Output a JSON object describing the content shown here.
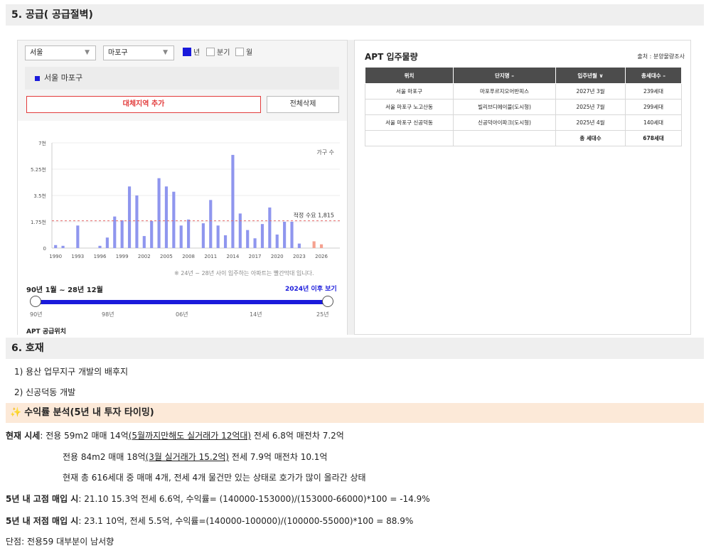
{
  "section5": {
    "title": "5. 공급( 공급절벽)"
  },
  "supply_panel": {
    "city": "서울",
    "district": "마포구",
    "period_options": [
      "년",
      "분기",
      "월"
    ],
    "period_selected": "년",
    "region_tag": "서울 마포구",
    "compare_button": "대체지역 추가",
    "delete_all_button": "전체삭제",
    "chart_note": "※ 24년 ~ 28년 사이 입주하는 아파트는 빨간막대 입니다.",
    "range_label": "90년 1월 ~ 28년 12월",
    "after_link": "2024년 이후 보기",
    "slider_ticks": [
      "90년",
      "98년",
      "06년",
      "14년",
      "25년"
    ],
    "location_label": "APT 공급위치"
  },
  "chart_data": {
    "type": "bar",
    "title": "",
    "legend": "가구 수",
    "xlabel": "",
    "ylabel": "",
    "ylim": [
      0,
      7000
    ],
    "ytick_labels": [
      "0",
      "1.75천",
      "3.5천",
      "5.25천",
      "7천"
    ],
    "xtick_labels": [
      "1990",
      "1993",
      "1996",
      "1999",
      "2002",
      "2005",
      "2008",
      "2011",
      "2014",
      "2017",
      "2020",
      "2023",
      "2026"
    ],
    "categories": [
      "1990",
      "1991",
      "1992",
      "1993",
      "1994",
      "1995",
      "1996",
      "1997",
      "1998",
      "1999",
      "2000",
      "2001",
      "2002",
      "2003",
      "2004",
      "2005",
      "2006",
      "2007",
      "2008",
      "2009",
      "2010",
      "2011",
      "2012",
      "2013",
      "2014",
      "2015",
      "2016",
      "2017",
      "2018",
      "2019",
      "2020",
      "2021",
      "2022",
      "2023",
      "2024",
      "2025",
      "2026",
      "2027",
      "2028"
    ],
    "values": [
      200,
      150,
      0,
      1500,
      0,
      0,
      150,
      700,
      2100,
      1850,
      4100,
      3500,
      800,
      1800,
      4650,
      4100,
      3750,
      1500,
      1900,
      0,
      1650,
      3200,
      1500,
      850,
      6200,
      2300,
      1200,
      650,
      1600,
      2700,
      900,
      1750,
      1750,
      300,
      0,
      450,
      250,
      0,
      0
    ],
    "red_from_year": 2024,
    "reference_line": {
      "label": "적정 수요 1,815",
      "value": 1815
    },
    "colors": {
      "bar": "#8f96ee",
      "future_bar": "#f5a190",
      "reference": "#e36a6a"
    }
  },
  "apt_table": {
    "title": "APT 입주물량",
    "source": "출처 : 분양물량조사",
    "headers": [
      "위치",
      "단지명 –",
      "입주년월 ∨",
      "총세대수 –"
    ],
    "rows": [
      [
        "서울 마포구",
        "마포푸르지오어반피스",
        "2027년 3월",
        "239세대"
      ],
      [
        "서울 마포구 노고산동",
        "빌리브디에이블(도시형)",
        "2025년 7월",
        "299세대"
      ],
      [
        "서울 마포구 신공덕동",
        "신공덕아이파크(도시형)",
        "2025년 4월",
        "140세대"
      ]
    ],
    "total_label": "총 세대수",
    "total_value": "678세대"
  },
  "section6": {
    "title": "6. 호재"
  },
  "hojae_items": [
    "1) 용산 업무지구 개발의 배후지",
    "2) 신공덕동 개발"
  ],
  "roi": {
    "icon": "✨",
    "title": "수익률 분석(5년 내 투자 타이밍)"
  },
  "price": {
    "label": "현재 시세",
    "line1_pre": ": 전용 59m2 매매 14억",
    "line1_u": "(5월까지만해도 실거래가 12억대)",
    "line1_post": " 전세 6.8억 매전차 7.2억",
    "line2_pre": "전용 84m2 매매 18억",
    "line2_u": "(3월 실거래가 15.2억)",
    "line2_post": " 전세 7.9억 매전차 10.1억",
    "line3": "현재 총 616세대 중 매매 4개, 전세 4개 물건만 있는 상태로 호가가 많이 올라간 상태"
  },
  "analysis": {
    "high_label": "5년 내 고점 매입 시",
    "high_text": ": 21.10 15.3억 전세 6.6억, 수익률= (140000-153000)/(153000-66000)*100 = -14.9%",
    "low_label": "5년 내 저점 매입 시",
    "low_text": ": 23.1 10억, 전세 5.5억, 수익률=(140000-100000)/(100000-55000)*100 = 88.9%",
    "downside": "단점: 전용59 대부분이 남서향"
  }
}
